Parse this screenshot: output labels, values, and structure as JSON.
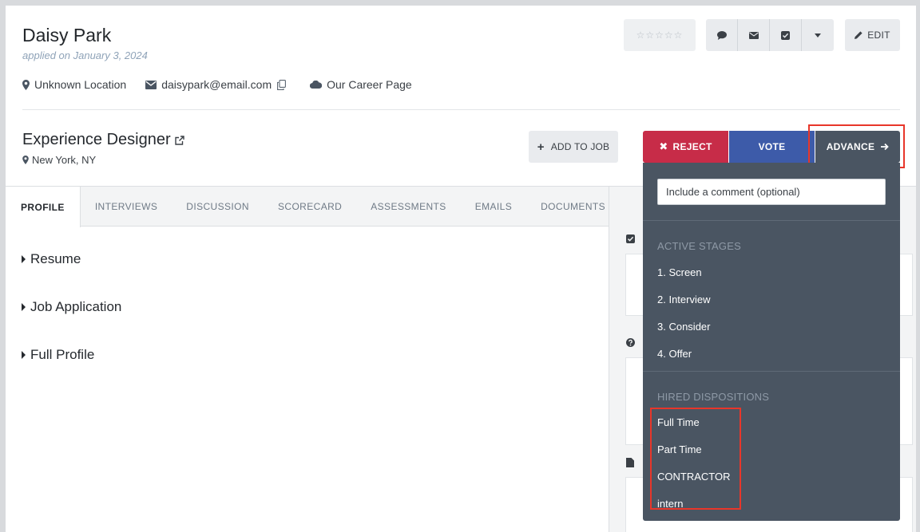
{
  "candidate": {
    "name": "Daisy Park",
    "applied": "applied on January 3, 2024",
    "location": "Unknown Location",
    "email": "daisypark@email.com",
    "source": "Our Career Page",
    "rating_stars": "☆☆☆☆☆"
  },
  "toolbar": {
    "edit_label": "EDIT"
  },
  "job": {
    "title": "Experience Designer",
    "location": "New York, NY",
    "add_to_job_label": "ADD TO JOB",
    "add_to_job_plus": "+"
  },
  "actions": {
    "reject_label": "REJECT",
    "reject_icon_glyph": "✖",
    "vote_label": "VOTE",
    "advance_label": "ADVANCE"
  },
  "tabs": [
    {
      "label": "PROFILE"
    },
    {
      "label": "INTERVIEWS"
    },
    {
      "label": "DISCUSSION"
    },
    {
      "label": "SCORECARD"
    },
    {
      "label": "ASSESSMENTS"
    },
    {
      "label": "EMAILS"
    },
    {
      "label": "DOCUMENTS"
    }
  ],
  "sections": [
    {
      "label": "Resume"
    },
    {
      "label": "Job Application"
    },
    {
      "label": "Full Profile"
    }
  ],
  "dropdown": {
    "comment_placeholder": "Include a comment (optional)",
    "active_stages_heading": "ACTIVE STAGES",
    "active_stages": [
      "1. Screen",
      "2. Interview",
      "3. Consider",
      "4. Offer"
    ],
    "hired_heading": "HIRED DISPOSITIONS",
    "hired": [
      "Full Time",
      "Part Time",
      "CONTRACTOR",
      "intern"
    ]
  },
  "colors": {
    "reject": "#c72c48",
    "vote": "#3d5ba9",
    "advance": "#4a5562",
    "highlight": "#e8362a"
  }
}
